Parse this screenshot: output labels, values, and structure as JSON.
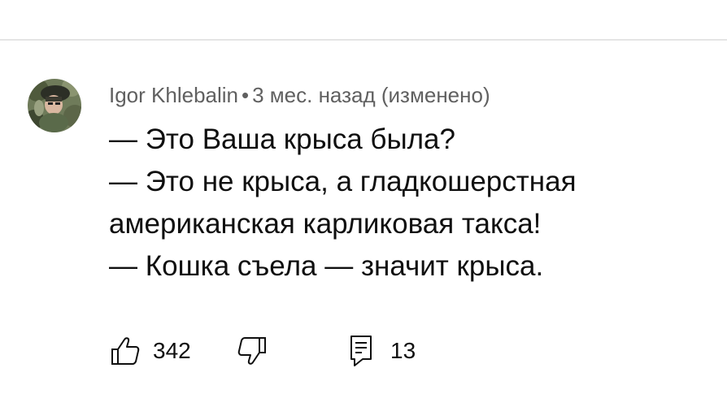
{
  "comment": {
    "author": "Igor Khlebalin",
    "separator": "•",
    "timestamp": "3 мес. назад (изменено)",
    "lines": [
      "— Это Ваша крыса была?",
      "— Это не крыса, а гладкошерстная",
      "американская карликовая такса!",
      "— Кошка съела — значит крыса."
    ],
    "likes": "342",
    "replies": "13"
  },
  "icons": {
    "like": "thumbs-up-icon",
    "dislike": "thumbs-down-icon",
    "reply": "comment-icon"
  },
  "colors": {
    "text": "#0f0f0f",
    "meta": "#606060",
    "divider": "#e5e5e5"
  }
}
